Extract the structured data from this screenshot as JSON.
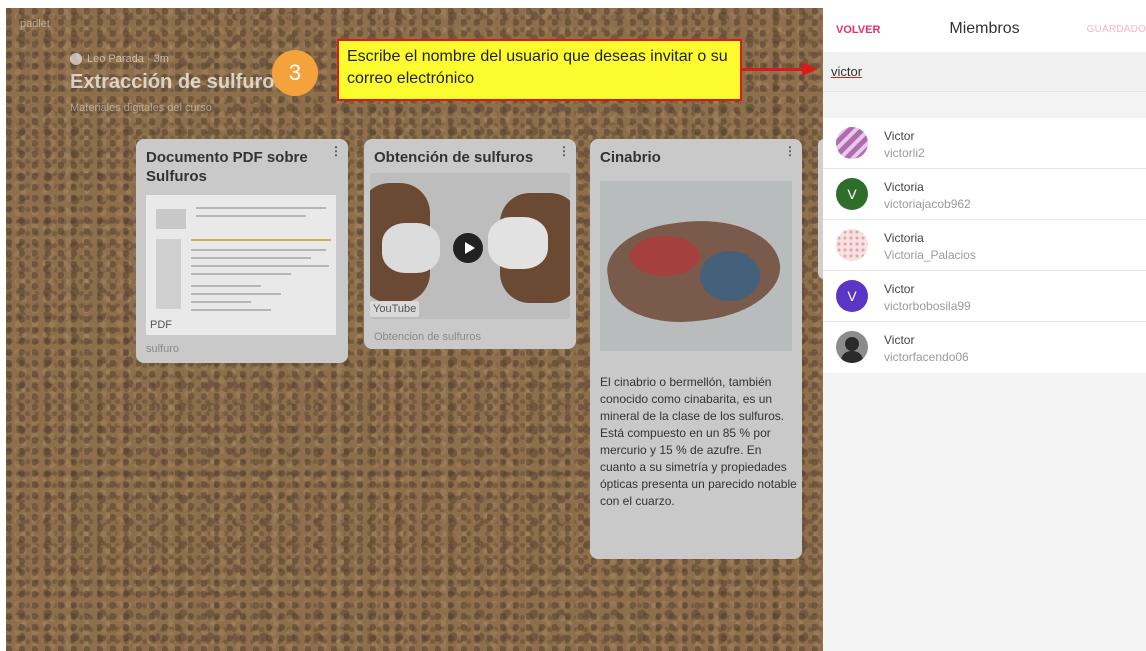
{
  "board": {
    "logo": "padlet",
    "author": "Leo Parada · 3m",
    "title": "Extracción de sulfuros",
    "subtitle": "Materiales digitales del curso",
    "cards": [
      {
        "title": "Documento PDF sobre Sulfuros",
        "badge": "PDF",
        "caption": "sulfuro"
      },
      {
        "title": "Obtención de sulfuros",
        "badge": "YouTube",
        "caption": "Obtencion de sulfuros"
      },
      {
        "title": "Cinabrio",
        "body": "El cinabrio o bermellón, también conocido como cinabarita, es un mineral de la clase de los sulfuros. Está compuesto en un 85 % por mercurio y 15 % de azufre. En cuanto a su simetría y propiedades ópticas presenta un parecido notable con el cuarzo."
      }
    ]
  },
  "annotation": {
    "step": "3",
    "text": "Escribe el nombre del usuario que deseas invitar o su correo electrónico"
  },
  "panel": {
    "back_label": "VOLVER",
    "title": "Miembros",
    "saved_label": "GUARDADO",
    "search_value": "victor",
    "members": [
      {
        "name": "Victor",
        "username": "victorli2",
        "avatar": "stripes"
      },
      {
        "name": "Victoria",
        "username": "victoriajacob962",
        "avatar": "V"
      },
      {
        "name": "Victoria",
        "username": "Victoria_Palacios",
        "avatar": "dots"
      },
      {
        "name": "Victor",
        "username": "victorbobosila99",
        "avatar": "V"
      },
      {
        "name": "Victor",
        "username": "victorfacendo06",
        "avatar": "photo"
      }
    ]
  },
  "colors": {
    "accent": "#e0316e",
    "callout_bg": "#fbfb2d",
    "callout_border": "#d81b1b",
    "step_circle": "#f4a23c"
  }
}
